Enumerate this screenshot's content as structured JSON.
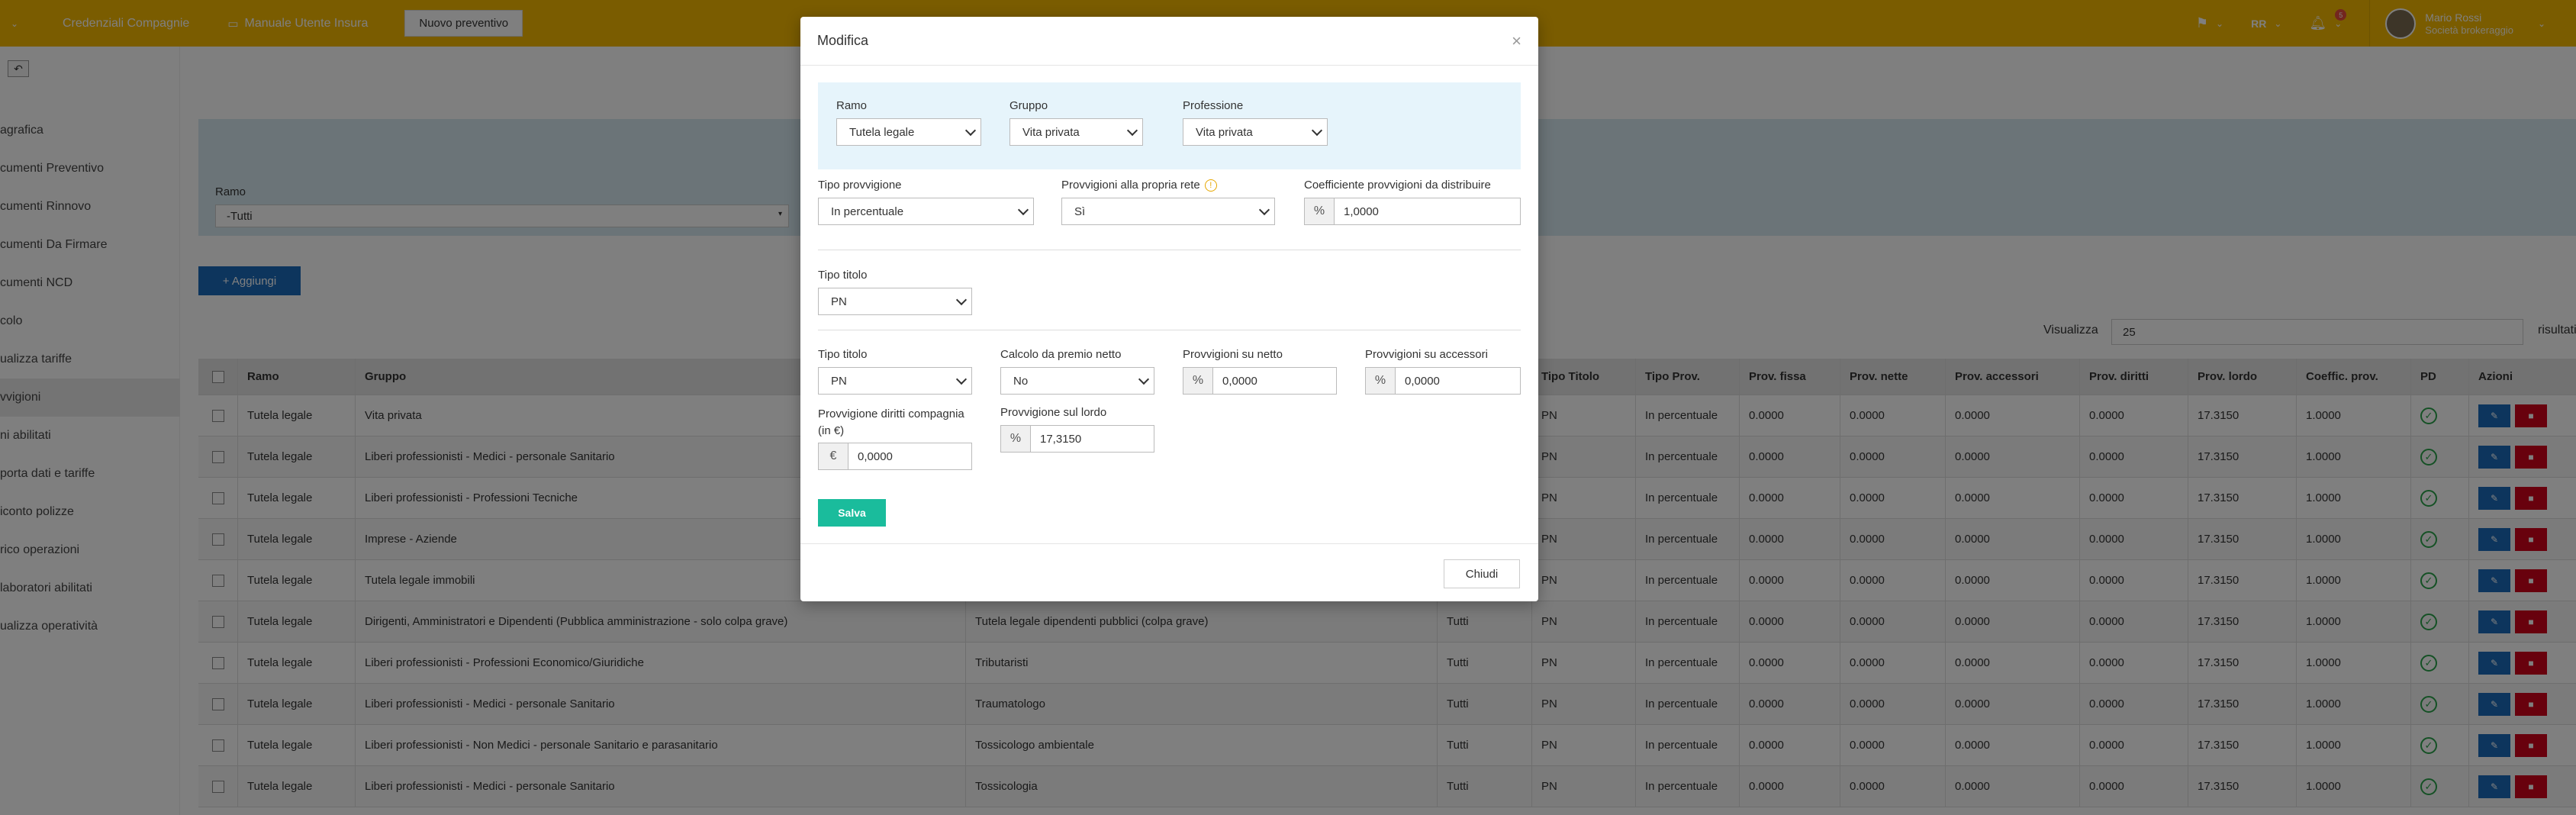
{
  "topbar": {
    "items": [
      {
        "label": "Credenziali Compagnie"
      },
      {
        "label": "Manuale Utente Insura"
      }
    ],
    "new_quote": "Nuovo preventivo",
    "notifications_count": "5",
    "user": {
      "name": "Mario Rossi",
      "company": "Società brokeraggio"
    },
    "colors": {
      "bar": "#f5b800"
    }
  },
  "sidebar": {
    "items": [
      {
        "label": "agrafica"
      },
      {
        "label": "cumenti Preventivo"
      },
      {
        "label": "cumenti Rinnovo"
      },
      {
        "label": "cumenti Da Firmare"
      },
      {
        "label": "cumenti NCD"
      },
      {
        "label": "colo"
      },
      {
        "label": "ualizza tariffe"
      },
      {
        "label": "vvigioni"
      },
      {
        "label": "ni abilitati"
      },
      {
        "label": "porta dati e tariffe"
      },
      {
        "label": "iconto polizze"
      },
      {
        "label": "rico operazioni"
      },
      {
        "label": "laboratori abilitati"
      },
      {
        "label": "ualizza operatività"
      }
    ]
  },
  "filters": {
    "ramo_label": "Ramo",
    "ramo_value": "-Tutti"
  },
  "add_button": "+ Aggiungi",
  "visualizza": {
    "label": "Visualizza",
    "value": "25",
    "suffix": "risultati per pa"
  },
  "table": {
    "headers": {
      "ramo": "Ramo",
      "gruppo": "Gruppo",
      "tipo_titolo": "Tipo Titolo",
      "tipo_prov": "Tipo Prov.",
      "prov_fissa": "Prov. fissa",
      "prov_nette": "Prov. nette",
      "prov_accessori": "Prov. accessori",
      "prov_diritti": "Prov. diritti",
      "prov_lordo": "Prov. lordo",
      "coeffic": "Coeffic. prov.",
      "pd": "PD",
      "azioni": "Azioni"
    },
    "rows": [
      {
        "ramo": "Tutela legale",
        "gruppo": "Vita privata",
        "professione": "",
        "col4": "",
        "tipo_titolo": "PN",
        "tipo_prov": "In percentuale",
        "fissa": "0.0000",
        "nette": "0.0000",
        "accessori": "0.0000",
        "diritti": "0.0000",
        "lordo": "17.3150",
        "coeff": "1.0000"
      },
      {
        "ramo": "Tutela legale",
        "gruppo": "Liberi professionisti - Medici - personale Sanitario",
        "professione": "",
        "col4": "",
        "tipo_titolo": "PN",
        "tipo_prov": "In percentuale",
        "fissa": "0.0000",
        "nette": "0.0000",
        "accessori": "0.0000",
        "diritti": "0.0000",
        "lordo": "17.3150",
        "coeff": "1.0000"
      },
      {
        "ramo": "Tutela legale",
        "gruppo": "Liberi professionisti - Professioni Tecniche",
        "professione": "",
        "col4": "",
        "tipo_titolo": "PN",
        "tipo_prov": "In percentuale",
        "fissa": "0.0000",
        "nette": "0.0000",
        "accessori": "0.0000",
        "diritti": "0.0000",
        "lordo": "17.3150",
        "coeff": "1.0000"
      },
      {
        "ramo": "Tutela legale",
        "gruppo": "Imprese - Aziende",
        "professione": "",
        "col4": "",
        "tipo_titolo": "PN",
        "tipo_prov": "In percentuale",
        "fissa": "0.0000",
        "nette": "0.0000",
        "accessori": "0.0000",
        "diritti": "0.0000",
        "lordo": "17.3150",
        "coeff": "1.0000"
      },
      {
        "ramo": "Tutela legale",
        "gruppo": "Tutela legale immobili",
        "professione": "",
        "col4": "",
        "tipo_titolo": "PN",
        "tipo_prov": "In percentuale",
        "fissa": "0.0000",
        "nette": "0.0000",
        "accessori": "0.0000",
        "diritti": "0.0000",
        "lordo": "17.3150",
        "coeff": "1.0000"
      },
      {
        "ramo": "Tutela legale",
        "gruppo": "Dirigenti, Amministratori e Dipendenti (Pubblica amministrazione - solo colpa grave)",
        "professione": "Tutela legale dipendenti pubblici (colpa grave)",
        "col4": "Tutti",
        "tipo_titolo": "PN",
        "tipo_prov": "In percentuale",
        "fissa": "0.0000",
        "nette": "0.0000",
        "accessori": "0.0000",
        "diritti": "0.0000",
        "lordo": "17.3150",
        "coeff": "1.0000"
      },
      {
        "ramo": "Tutela legale",
        "gruppo": "Liberi professionisti - Professioni Economico/Giuridiche",
        "professione": "Tributaristi",
        "col4": "Tutti",
        "tipo_titolo": "PN",
        "tipo_prov": "In percentuale",
        "fissa": "0.0000",
        "nette": "0.0000",
        "accessori": "0.0000",
        "diritti": "0.0000",
        "lordo": "17.3150",
        "coeff": "1.0000"
      },
      {
        "ramo": "Tutela legale",
        "gruppo": "Liberi professionisti - Medici - personale Sanitario",
        "professione": "Traumatologo",
        "col4": "Tutti",
        "tipo_titolo": "PN",
        "tipo_prov": "In percentuale",
        "fissa": "0.0000",
        "nette": "0.0000",
        "accessori": "0.0000",
        "diritti": "0.0000",
        "lordo": "17.3150",
        "coeff": "1.0000"
      },
      {
        "ramo": "Tutela legale",
        "gruppo": "Liberi professionisti - Non Medici - personale Sanitario e parasanitario",
        "professione": "Tossicologo ambientale",
        "col4": "Tutti",
        "tipo_titolo": "PN",
        "tipo_prov": "In percentuale",
        "fissa": "0.0000",
        "nette": "0.0000",
        "accessori": "0.0000",
        "diritti": "0.0000",
        "lordo": "17.3150",
        "coeff": "1.0000"
      },
      {
        "ramo": "Tutela legale",
        "gruppo": "Liberi professionisti - Medici - personale Sanitario",
        "professione": "Tossicologia",
        "col4": "Tutti",
        "tipo_titolo": "PN",
        "tipo_prov": "In percentuale",
        "fissa": "0.0000",
        "nette": "0.0000",
        "accessori": "0.0000",
        "diritti": "0.0000",
        "lordo": "17.3150",
        "coeff": "1.0000"
      }
    ]
  },
  "modal": {
    "title": "Modifica",
    "ramo": {
      "label": "Ramo",
      "value": "Tutela legale"
    },
    "gruppo": {
      "label": "Gruppo",
      "value": "Vita privata"
    },
    "professione": {
      "label": "Professione",
      "value": "Vita privata"
    },
    "tipo_provvigione": {
      "label": "Tipo provvigione",
      "value": "In percentuale"
    },
    "provv_rete": {
      "label": "Provvigioni alla propria rete",
      "value": "Sì"
    },
    "coefficiente": {
      "label": "Coefficiente provvigioni da distribuire",
      "addon": "%",
      "value": "1,0000"
    },
    "tipo_titolo_1": {
      "label": "Tipo titolo",
      "value": "PN"
    },
    "tipo_titolo_2": {
      "label": "Tipo titolo",
      "value": "PN"
    },
    "calcolo": {
      "label": "Calcolo da premio netto",
      "value": "No"
    },
    "prov_netto": {
      "label": "Provvigioni su netto",
      "addon": "%",
      "value": "0,0000"
    },
    "prov_accessori": {
      "label": "Provvigioni su accessori",
      "addon": "%",
      "value": "0,0000"
    },
    "prov_diritti": {
      "label": "Provvigione diritti compagnia (in €)",
      "addon": "€",
      "value": "0,0000"
    },
    "prov_lordo": {
      "label": "Provvigione sul lordo",
      "addon": "%",
      "value": "17,3150"
    },
    "save": "Salva",
    "close": "Chiudi"
  }
}
